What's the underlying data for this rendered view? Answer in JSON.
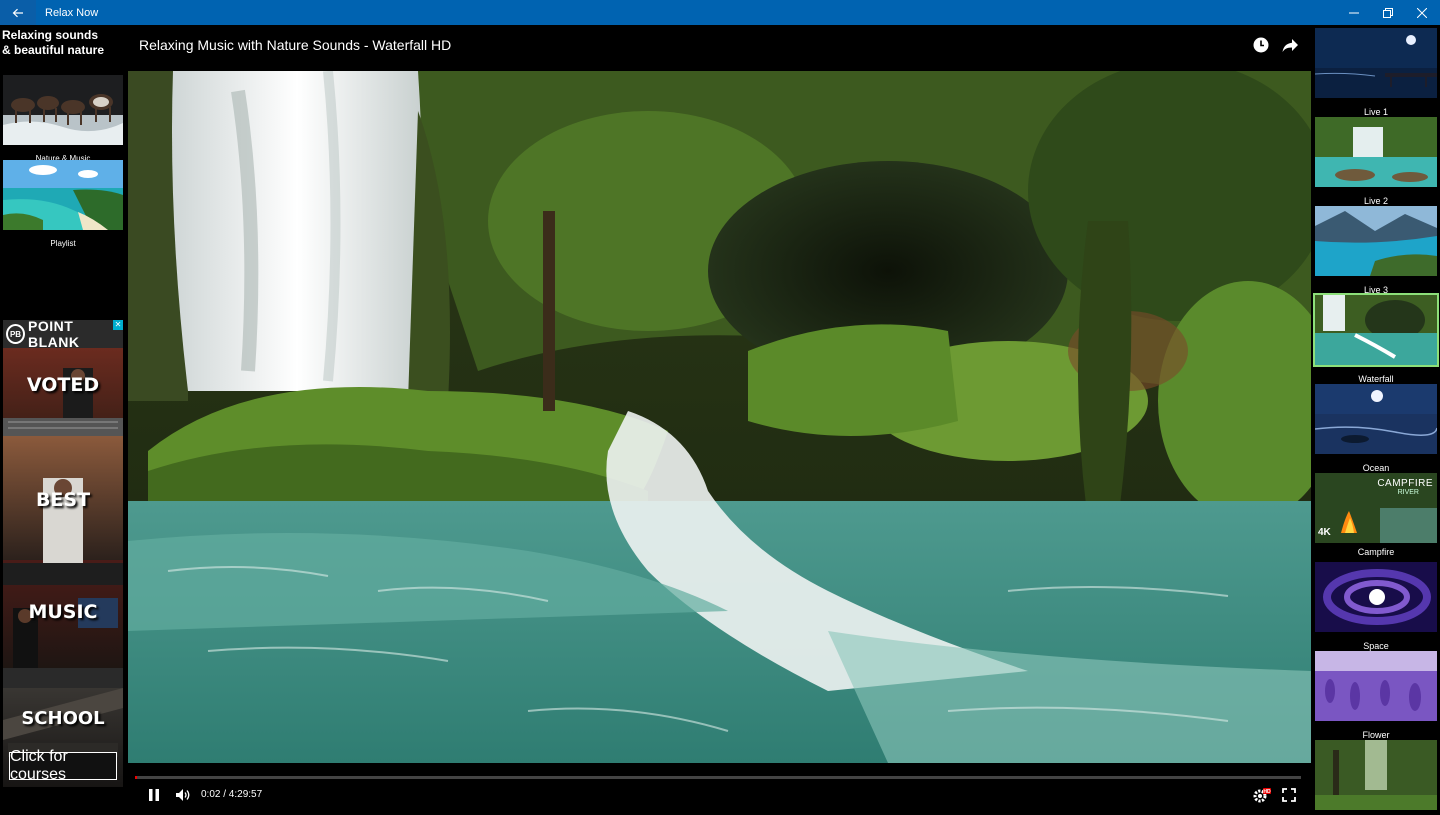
{
  "window": {
    "title": "Relax Now"
  },
  "sidebar": {
    "heading_line1": "Relaxing sounds",
    "heading_line2": "& beautiful nature",
    "items": [
      {
        "label": "Nature & Music"
      },
      {
        "label": "Playlist"
      }
    ]
  },
  "ad": {
    "brand": "POINT BLANK",
    "brand_logo": "PB",
    "close_glyph": "✕",
    "words": [
      "VOTED",
      "BEST",
      "MUSIC",
      "SCHOOL"
    ],
    "cta": "Click for courses"
  },
  "player": {
    "title": "Relaxing Music with Nature Sounds - Waterfall HD",
    "time": "0:02 / 4:29:57",
    "progress_fraction": 0.0,
    "hd_badge": "HD"
  },
  "channels": [
    {
      "label": "Live 1"
    },
    {
      "label": "Live 2"
    },
    {
      "label": "Live 3"
    },
    {
      "label": "Waterfall",
      "selected": true
    },
    {
      "label": "Ocean"
    },
    {
      "label": "Campfire",
      "overlay_title": "CAMPFIRE",
      "overlay_sub": "RIVER",
      "overlay_badge": "4K"
    },
    {
      "label": "Space"
    },
    {
      "label": "Flower"
    },
    {
      "label": ""
    }
  ],
  "colors": {
    "titlebar": "#0063b1",
    "selected_outline": "#8de07a",
    "progress": "#e00000"
  }
}
